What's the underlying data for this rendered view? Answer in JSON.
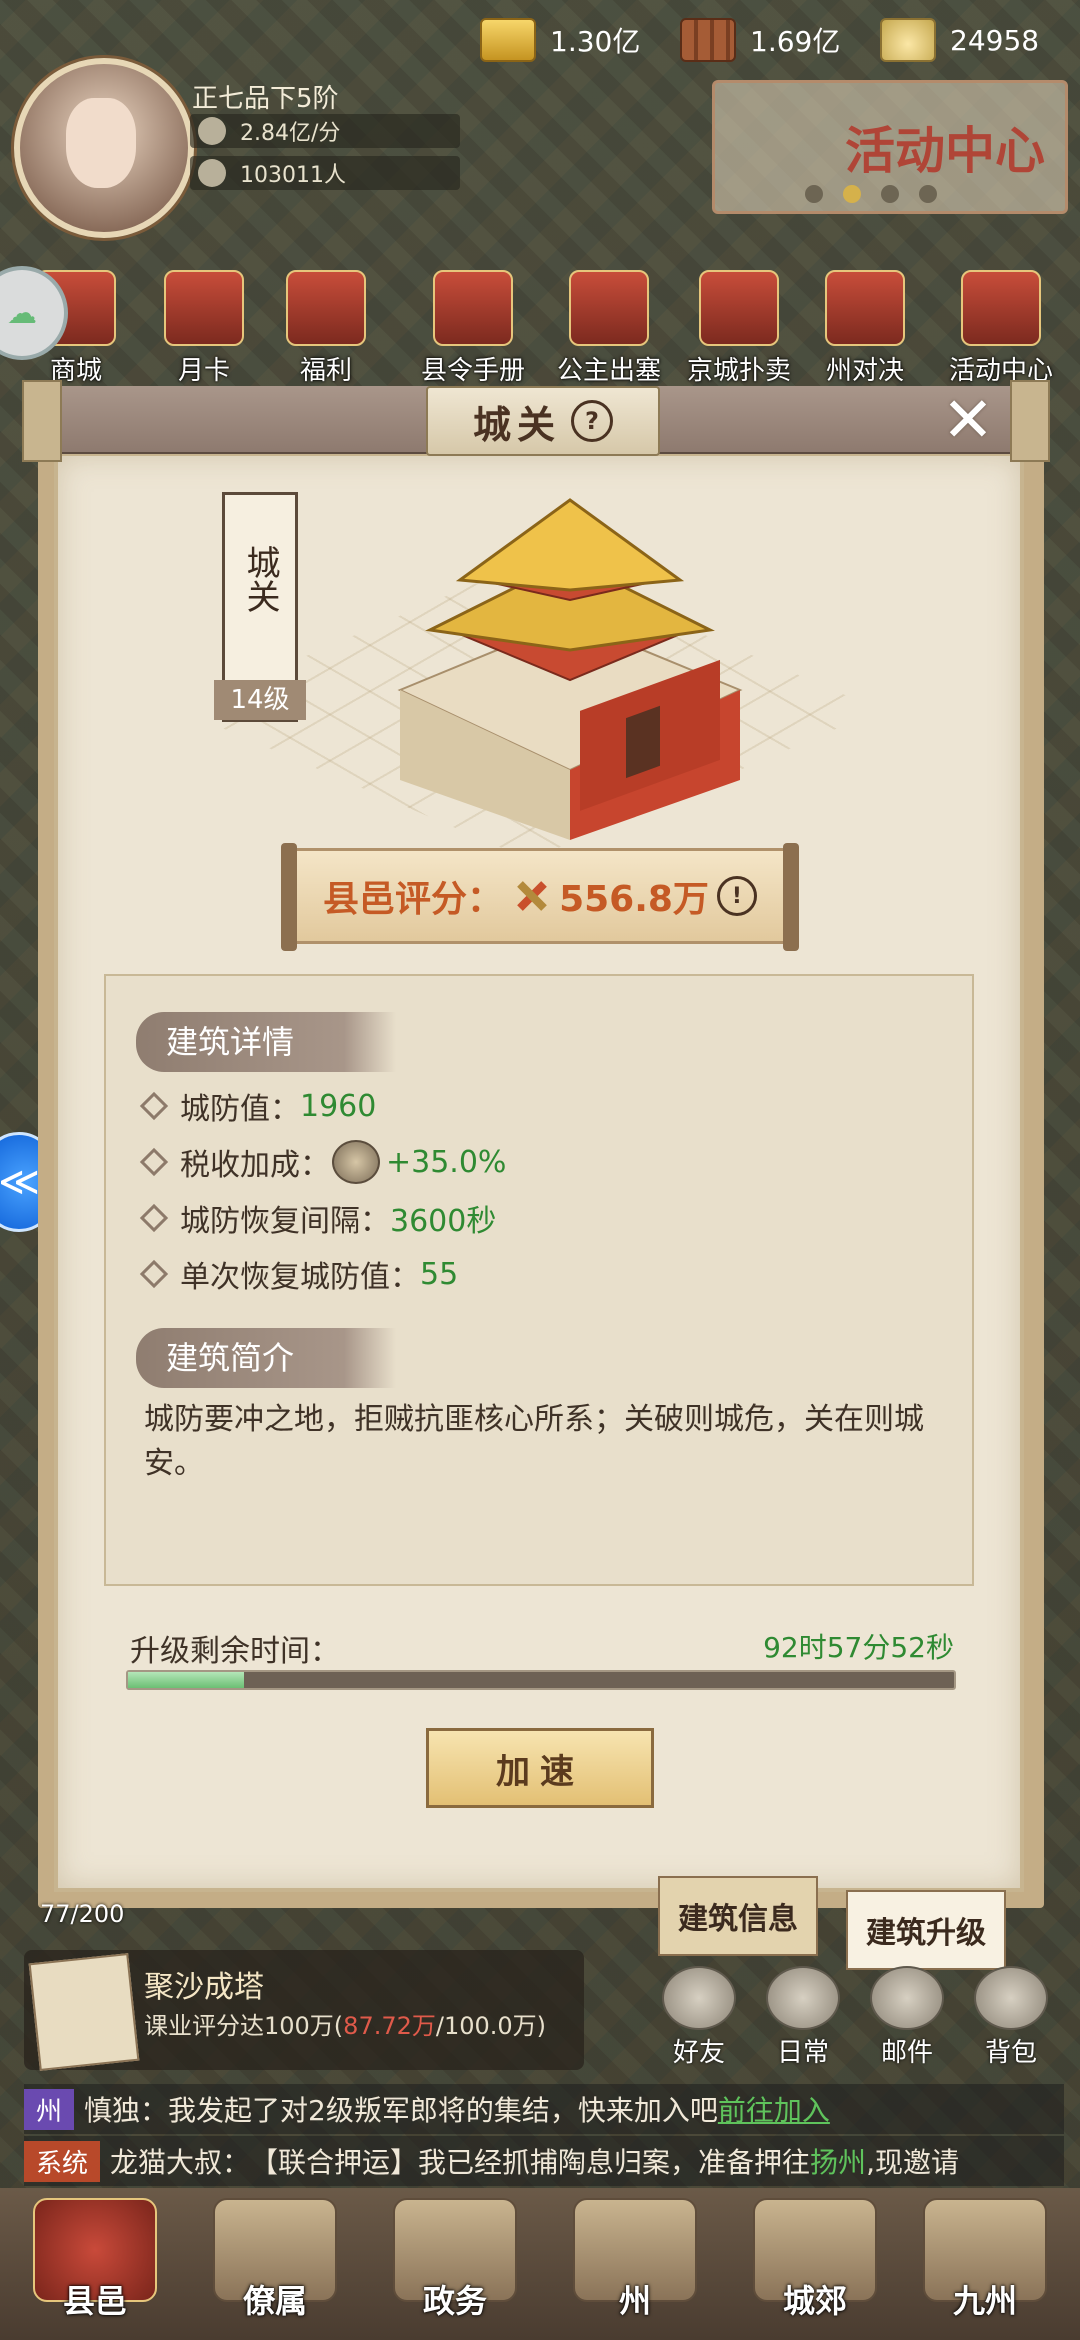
{
  "top_resources": [
    {
      "icon": "gold-bar-icon",
      "value": "1.30亿"
    },
    {
      "icon": "wood-icon",
      "value": "1.69亿"
    },
    {
      "icon": "ingot-icon",
      "value": "24958"
    }
  ],
  "player": {
    "rank": "正七品下5阶",
    "income": "2.84亿/分",
    "population": "103011人"
  },
  "activity_banner": "活动中心",
  "quick_icons": [
    "商城",
    "月卡",
    "福利",
    "县令手册",
    "公主出塞",
    "京城扑卖",
    "州对决",
    "活动中心"
  ],
  "modal": {
    "title": "城关",
    "building_name": "城关",
    "level": "14级",
    "score_label": "县邑评分：",
    "score_value": "556.8万",
    "details_header": "建筑详情",
    "stats": [
      {
        "label": "城防值：",
        "value": "1960"
      },
      {
        "label": "税收加成：",
        "value": "+35.0%"
      },
      {
        "label": "城防恢复间隔：",
        "value": "3600秒"
      },
      {
        "label": "单次恢复城防值：",
        "value": "55"
      }
    ],
    "intro_header": "建筑简介",
    "intro_text": "城防要冲之地，拒贼抗匪核心所系；关破则城危，关在则城安。",
    "timer_label": "升级剩余时间：",
    "timer_value": "92时57分52秒",
    "upgrade_progress": 0.14,
    "speed_button": "加速",
    "tabs": [
      "建筑信息",
      "建筑升级"
    ]
  },
  "task": {
    "count": "77/200",
    "title": "聚沙成塔",
    "desc_prefix": "课业评分达100万(",
    "desc_progress": "87.72万",
    "desc_suffix": "/100.0万)"
  },
  "mini_buttons": [
    "好友",
    "日常",
    "邮件",
    "背包"
  ],
  "chat": [
    {
      "tag": "州",
      "sender": "慎独：",
      "text": "我发起了对2级叛军郎将的集结，快来加入吧",
      "link": "前往加入"
    },
    {
      "tag": "系统",
      "sender": "龙猫大叔：",
      "text1": "【联合押运】我已经抓捕陶息归案，准备押往",
      "place": "扬州",
      "text2": ",现邀请"
    }
  ],
  "nav": [
    "县邑",
    "僚属",
    "政务",
    "州",
    "城郊",
    "九州"
  ],
  "colors": {
    "green": "#2f8a32",
    "orange": "#c55a25",
    "panel": "#ede5d4"
  }
}
